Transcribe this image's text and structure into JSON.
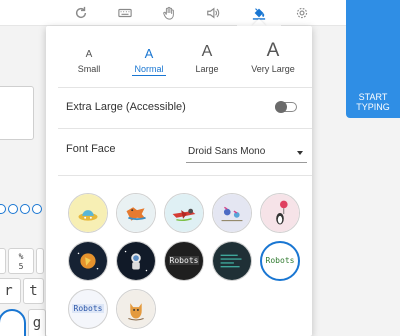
{
  "toolbar": {
    "icons": [
      "refresh-icon",
      "keyboard-icon",
      "hand-icon",
      "volume-icon",
      "paint-bucket-icon",
      "gear-icon"
    ],
    "active": "paint-bucket-icon",
    "accent": "#1976d2"
  },
  "background": {
    "start_button": {
      "line1": "START",
      "line2": "TYPING",
      "color": "#2f8ee5"
    },
    "keys": [
      "%",
      "5",
      "r",
      "t",
      "g"
    ]
  },
  "panel": {
    "text_sizes": [
      {
        "glyph": "A",
        "name": "Small"
      },
      {
        "glyph": "A",
        "name": "Normal"
      },
      {
        "glyph": "A",
        "name": "Large"
      },
      {
        "glyph": "A",
        "name": "Very Large"
      }
    ],
    "selected_size": "Normal",
    "extra_large": {
      "label": "Extra Large (Accessible)",
      "enabled": false
    },
    "font_face": {
      "label": "Font Face",
      "value": "Droid Sans Mono"
    },
    "themes": [
      {
        "name": "theme-yellow-ufo"
      },
      {
        "name": "theme-fox"
      },
      {
        "name": "theme-red-plane"
      },
      {
        "name": "theme-birds"
      },
      {
        "name": "theme-penguin-balloon"
      },
      {
        "name": "theme-dark-rocket"
      },
      {
        "name": "theme-dark-astronaut"
      },
      {
        "name": "theme-robots-dark",
        "text": "Robots"
      },
      {
        "name": "theme-terminal"
      },
      {
        "name": "theme-robots-light",
        "text": "Robots",
        "selected": true
      },
      {
        "name": "theme-robots-blue",
        "text": "Robots"
      },
      {
        "name": "theme-cat"
      }
    ]
  }
}
